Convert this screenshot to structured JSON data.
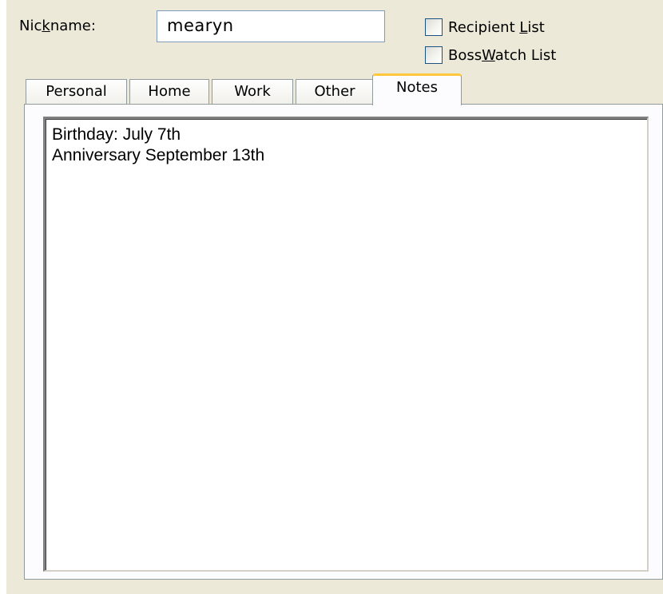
{
  "nickname": {
    "label_before": "Nic",
    "label_access": "k",
    "label_after": "name:",
    "value": "mearyn"
  },
  "lists": {
    "recipient": {
      "before": "Recipient ",
      "access": "L",
      "after": "ist",
      "checked": false
    },
    "bosswatch": {
      "before": "Boss",
      "access": "W",
      "after": "atch List",
      "checked": false
    }
  },
  "tabs": [
    {
      "label": "Personal"
    },
    {
      "label": "Home"
    },
    {
      "label": "Work"
    },
    {
      "label": "Other"
    },
    {
      "label": "Notes"
    }
  ],
  "active_tab": "Notes",
  "notes": {
    "lines": [
      "Birthday: July 7th",
      "Anniversary September 13th"
    ]
  },
  "colors": {
    "dialog_background": "#ece9d8",
    "active_tab_highlight": "#ffc83c",
    "checkbox_border": "#1c5180",
    "input_border": "#7f9db9"
  }
}
